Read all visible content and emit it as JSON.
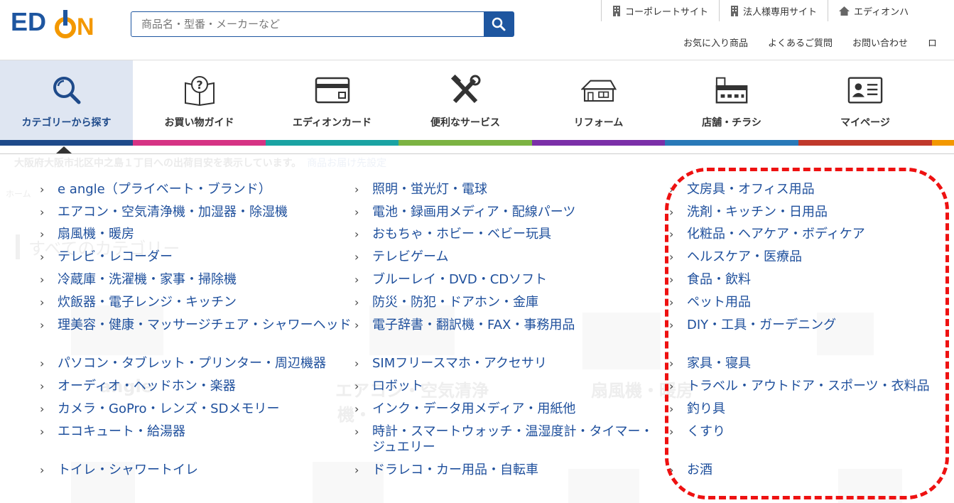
{
  "header": {
    "logo_text": "EDION",
    "search_placeholder": "商品名・型番・メーカーなど",
    "top_links": [
      {
        "label": "コーポレートサイト",
        "icon": "building-icon"
      },
      {
        "label": "法人様専用サイト",
        "icon": "building-icon"
      },
      {
        "label": "エディオンハ",
        "icon": "home-icon"
      }
    ],
    "sub_links": [
      "お気に入り商品",
      "よくあるご質問",
      "お問い合わせ",
      "ロ"
    ]
  },
  "nav": {
    "items": [
      {
        "label": "カテゴリーから探す",
        "icon": "magnifier-icon",
        "color": "#1e4a8a"
      },
      {
        "label": "お買い物ガイド",
        "icon": "guide-book-icon",
        "color": "#d63384"
      },
      {
        "label": "エディオンカード",
        "icon": "card-icon",
        "color": "#1aa3a3"
      },
      {
        "label": "便利なサービス",
        "icon": "tools-icon",
        "color": "#7cb342"
      },
      {
        "label": "リフォーム",
        "icon": "house-icon",
        "color": "#7b2fa8"
      },
      {
        "label": "店舗・チラシ",
        "icon": "store-icon",
        "color": "#2979b8"
      },
      {
        "label": "マイページ",
        "icon": "id-card-icon",
        "color": "#c0392b"
      }
    ]
  },
  "background": {
    "location_text": "大阪府大阪市北区中之島１丁目への出荷目安を表示しています。",
    "location_link": "商品お届け先設定",
    "breadcrumb": "ホーム",
    "heading": "すべてのカテゴリー",
    "card_labels": [
      "angle",
      "エアコン・空気清浄",
      "機・",
      "扇風機・暖房"
    ]
  },
  "categories": {
    "col1": [
      "e angle（プライベート・ブランド）",
      "エアコン・空気清浄機・加湿器・除湿機",
      "扇風機・暖房",
      "テレビ・レコーダー",
      "冷蔵庫・洗濯機・家事・掃除機",
      "炊飯器・電子レンジ・キッチン",
      "理美容・健康・マッサージチェア・シャワーヘッド",
      "パソコン・タブレット・プリンター・周辺機器",
      "オーディオ・ヘッドホン・楽器",
      "カメラ・GoPro・レンズ・SDメモリー",
      "エコキュート・給湯器",
      "トイレ・シャワートイレ"
    ],
    "col2": [
      "照明・蛍光灯・電球",
      "電池・録画用メディア・配線パーツ",
      "おもちゃ・ホビー・ベビー玩具",
      "テレビゲーム",
      "ブルーレイ・DVD・CDソフト",
      "防災・防犯・ドアホン・金庫",
      "電子辞書・翻訳機・FAX・事務用品",
      "SIMフリースマホ・アクセサリ",
      "ロボット",
      "インク・データ用メディア・用紙他",
      "時計・スマートウォッチ・温湿度計・タイマー・ジュエリー",
      "ドラレコ・カー用品・自転車"
    ],
    "col3": [
      "文房具・オフィス用品",
      "洗剤・キッチン・日用品",
      "化粧品・ヘアケア・ボディケア",
      "ヘルスケア・医療品",
      "食品・飲料",
      "ペット用品",
      "DIY・工具・ガーデニング",
      "家具・寝具",
      "トラベル・アウトドア・スポーツ・衣料品",
      "釣り具",
      "くすり",
      "お酒"
    ]
  },
  "colors": {
    "brand_blue": "#1e56a0",
    "logo_orange": "#f39800",
    "link_blue": "#1e4f9c",
    "highlight_red": "#ee1111"
  }
}
